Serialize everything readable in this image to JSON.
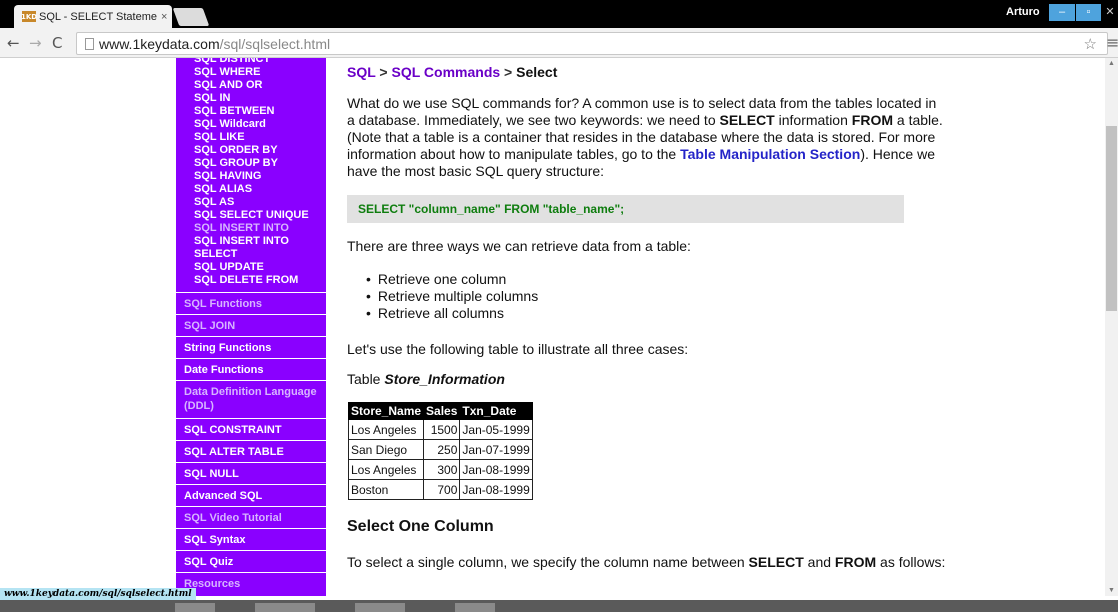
{
  "browser": {
    "tab_favicon": "1KD",
    "tab_title": "SQL - SELECT Statement |",
    "tab_close": "×",
    "user": "Arturo",
    "window_min": "–",
    "window_max": "▫",
    "window_close": "✕",
    "url_host": "www.1keydata.com",
    "url_path": "/sql/sqlselect.html",
    "back": "←",
    "forward": "→",
    "reload": "C",
    "star": "☆",
    "menu": "≡"
  },
  "sidebar": {
    "sub_items": [
      {
        "label": "SQL DISTINCT",
        "dim": false
      },
      {
        "label": "SQL WHERE",
        "dim": false
      },
      {
        "label": "SQL AND OR",
        "dim": false
      },
      {
        "label": "SQL IN",
        "dim": false
      },
      {
        "label": "SQL BETWEEN",
        "dim": false
      },
      {
        "label": "SQL Wildcard",
        "dim": false
      },
      {
        "label": "SQL LIKE",
        "dim": false
      },
      {
        "label": "SQL ORDER BY",
        "dim": false
      },
      {
        "label": "SQL GROUP BY",
        "dim": false
      },
      {
        "label": "SQL HAVING",
        "dim": false
      },
      {
        "label": "SQL ALIAS",
        "dim": false
      },
      {
        "label": "SQL AS",
        "dim": false
      },
      {
        "label": "SQL SELECT UNIQUE",
        "dim": false
      },
      {
        "label": "SQL INSERT INTO",
        "dim": true
      },
      {
        "label": "SQL INSERT INTO",
        "dim": false
      },
      {
        "label": "SELECT",
        "dim": false
      },
      {
        "label": "SQL UPDATE",
        "dim": false
      },
      {
        "label": "SQL DELETE FROM",
        "dim": false
      }
    ],
    "sections": [
      {
        "label": "SQL Functions",
        "dim": true
      },
      {
        "label": "SQL JOIN",
        "dim": true
      },
      {
        "label": "String Functions",
        "dim": false
      },
      {
        "label": "Date Functions",
        "dim": false
      },
      {
        "label": "Data Definition Language (DDL)",
        "dim": true,
        "tall": true
      },
      {
        "label": "SQL CONSTRAINT",
        "dim": false
      },
      {
        "label": "SQL ALTER TABLE",
        "dim": false
      },
      {
        "label": "SQL NULL",
        "dim": false
      },
      {
        "label": "Advanced SQL",
        "dim": false
      },
      {
        "label": "SQL Video Tutorial",
        "dim": true
      },
      {
        "label": "SQL Syntax",
        "dim": false
      },
      {
        "label": "SQL Quiz",
        "dim": false
      },
      {
        "label": "Resources",
        "dim": true
      }
    ]
  },
  "content": {
    "breadcrumb": {
      "sql": "SQL",
      "commands": "SQL Commands",
      "current": "Select",
      "sep": ">"
    },
    "intro": {
      "t1": "What do we use SQL commands for? A common use is to select data from the tables located in a database. Immediately, we see two keywords: we need to ",
      "k1": "SELECT",
      "t2": " information ",
      "k2": "FROM",
      "t3": " a table. (Note that a table is a container that resides in the database where the data is stored. For more information about how to manipulate tables, go to the ",
      "link": "Table Manipulation Section",
      "t4": "). Hence we have the most basic SQL query structure:"
    },
    "code": "SELECT \"column_name\" FROM \"table_name\";",
    "ways_intro": "There are three ways we can retrieve data from a table:",
    "ways": [
      "Retrieve one column",
      "Retrieve multiple columns",
      "Retrieve all columns"
    ],
    "table_intro": "Let's use the following table to illustrate all three cases:",
    "table_label": "Table ",
    "table_name": "Store_Information",
    "table": {
      "headers": [
        "Store_Name",
        "Sales",
        "Txn_Date"
      ],
      "rows": [
        [
          "Los Angeles",
          "1500",
          "Jan-05-1999"
        ],
        [
          "San Diego",
          "250",
          "Jan-07-1999"
        ],
        [
          "Los Angeles",
          "300",
          "Jan-08-1999"
        ],
        [
          "Boston",
          "700",
          "Jan-08-1999"
        ]
      ]
    },
    "section_heading": "Select One Column",
    "select_one": {
      "t1": "To select a single column, we specify the column name between ",
      "k1": "SELECT",
      "t2": " and ",
      "k2": "FROM",
      "t3": " as follows:"
    }
  },
  "status_url": "www.1keydata.com/sql/sqlselect.html"
}
